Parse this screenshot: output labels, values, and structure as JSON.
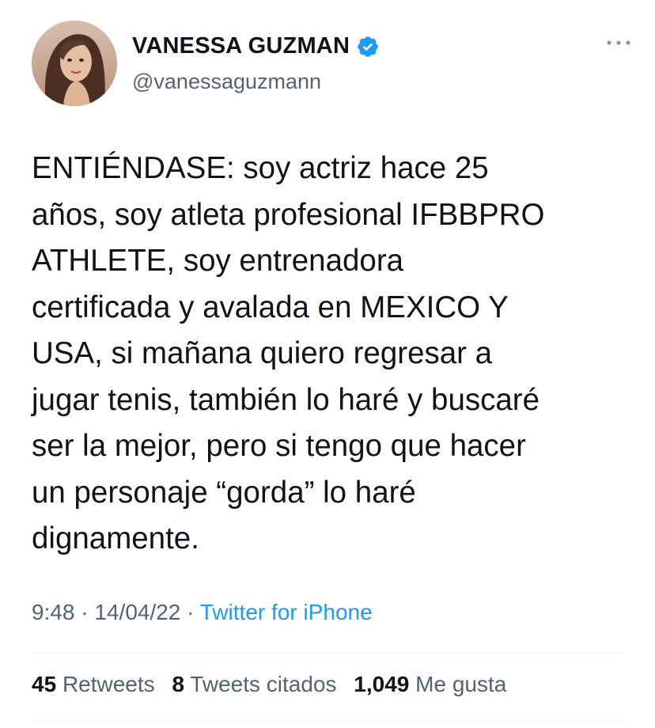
{
  "author": {
    "display_name": "VANESSA GUZMAN",
    "handle": "@vanessaguzmann",
    "verified": true,
    "verified_color": "#1d9bf0"
  },
  "tweet": {
    "lines": [
      "ENTIÉNDASE: soy actriz hace 25",
      "años, soy atleta profesional IFBBPRO",
      "ATHLETE, soy entrenadora",
      "certificada y avalada en MEXICO Y",
      "USA, si mañana quiero regresar a",
      "jugar tenis, también lo haré y buscaré",
      "ser la mejor, pero si tengo que hacer",
      "un personaje “gorda” lo haré",
      "dignamente."
    ]
  },
  "meta": {
    "time": "9:48",
    "separator": " · ",
    "date": "14/04/22",
    "source": "Twitter for iPhone"
  },
  "stats": {
    "retweets_count": "45",
    "retweets_label": "Retweets",
    "quotes_count": "8",
    "quotes_label": "Tweets citados",
    "likes_count": "1,049",
    "likes_label": "Me gusta"
  },
  "icons": {
    "more": "more-options-icon",
    "verified": "verified-badge-icon"
  }
}
